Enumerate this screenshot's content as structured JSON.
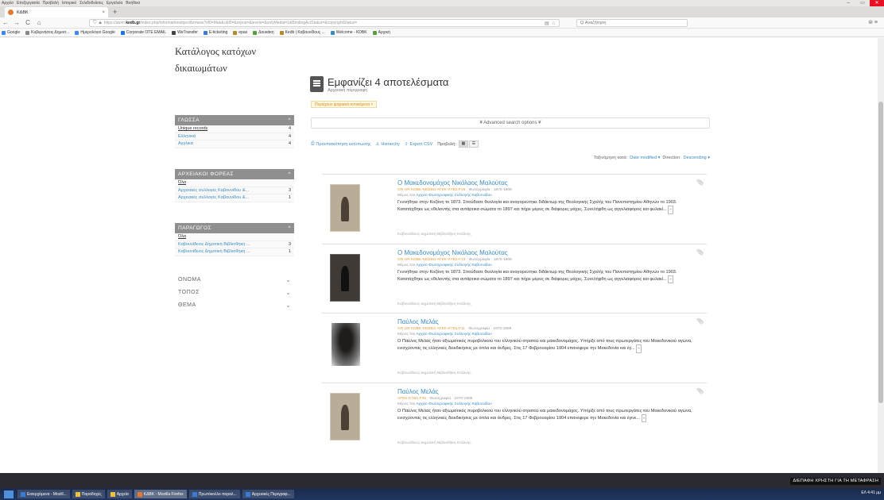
{
  "window": {
    "menu": [
      "Αρχείο",
      "Επεξεργασία",
      "Προβολή",
      "Ιστορικό",
      "Σελιδοδείκτες",
      "Εργαλεία",
      "Βοήθεια"
    ],
    "minimize": "–",
    "maximize": "▭",
    "close": "✕"
  },
  "tab": {
    "title": "ΚΔΒΚ",
    "close": "×",
    "new": "+"
  },
  "nav": {
    "back": "←",
    "forward": "→",
    "reload": "C",
    "home": "⌂",
    "url_prefix": "https://atom.",
    "url_domain": "kedb.gr",
    "url_path": "/index.php/informationobject/browse?sf0=Mak&c&f0=&repos=&levels=&onlyMedia=1&BindingActStatus=&copyrightStatus=",
    "search_placeholder": "Q Αναζήτηση",
    "right": "⊜ ≡"
  },
  "bookmarks": [
    {
      "label": "Google",
      "color": "#4285f4"
    },
    {
      "label": "Κυβερνήσεις Δημοσ...",
      "color": "#888888"
    },
    {
      "label": "Ημερολόγιο Google",
      "color": "#4285f4"
    },
    {
      "label": "Corporate OTE EMAIL",
      "color": "#1a73e8"
    },
    {
      "label": "WeTransfer",
      "color": "#444444"
    },
    {
      "label": "E-ticketing",
      "color": "#3a7bd5"
    },
    {
      "label": "epas",
      "color": "#b58a2e"
    },
    {
      "label": "Δουκάκη",
      "color": "#5a9c3a"
    },
    {
      "label": "Kedb | Καβουνίδους ...",
      "color": "#b58a2e"
    },
    {
      "label": "Welcome - KDBK",
      "color": "#3a8bbf"
    },
    {
      "label": "Αρχική",
      "color": "#5a9c3a"
    }
  ],
  "sidebar": {
    "title": "Κατάλογος κατόχων δικαιωμάτων",
    "facets": [
      {
        "heading": "ΓΛΩΣΣΑ",
        "rows": [
          {
            "label": "Unique records",
            "count": "4",
            "selected": true
          },
          {
            "label": "Ελληνικά",
            "count": "4"
          },
          {
            "label": "Αγγλικά",
            "count": "4"
          }
        ]
      },
      {
        "heading": "ΑΡΧΕΙΑΚΟΙ ΦΟΡΕΑΣ",
        "rows": [
          {
            "label": "Όλα",
            "count": "",
            "selected": true
          },
          {
            "label": "Αρχειακές συλλογές Καβουνίδου &...",
            "count": "3"
          },
          {
            "label": "Αρχειακές συλλογές Καβουνίδου &...",
            "count": "1"
          }
        ]
      },
      {
        "heading": "ΠΑΡΑΓΩΓΟΣ",
        "rows": [
          {
            "label": "Όλα",
            "count": "",
            "selected": true
          },
          {
            "label": "Καβουνίδειος Δημοτική Βιβλιοθήκη ...",
            "count": "3"
          },
          {
            "label": "Καβουνίδειος Δημοτική Βιβλιοθήκη ...",
            "count": "1"
          }
        ]
      }
    ],
    "collapsed": [
      "ΟΝΟΜΑ",
      "ΤΟΠΟΣ",
      "ΘΕΜΑ"
    ]
  },
  "main": {
    "title": "Εμφανίζει 4 αποτελέσματα",
    "subtitle": "Αρχειακή περιγραφή",
    "filter_tag": "Περιέχουν ψηφιακά αντικείμενα ×",
    "advanced": "¥ Advanced search options ¥",
    "toolbar": {
      "print": "Προεπισκόπηση εκτύπωσης",
      "hierarchy": "Hierarchy",
      "export": "Export CSV",
      "view_label": "Προβολή:"
    },
    "sort": {
      "label": "Ταξινόμηση κατά:",
      "by": "Date modified",
      "dir_label": "Direction:",
      "dir": "Descending"
    }
  },
  "results": [
    {
      "title": "Ο Μακεδονομάχος Νικόλαος Μαλούτας",
      "ref": "GR GR KDBK KEDBO AFEK-KTB1-F15",
      "level": "Φωτογραφία · 1870-1908",
      "part_prefix": "Μέρος του",
      "part_link": "Αρχείο Φωτογραφικής Συλλογής Καβουνίδου",
      "desc": "Γεννήθηκε στην Κοζάνη το 1873. Σπούδασε θεολογία και αναγορεύτηκε διδάκτωρ της Θεολογικής Σχολής του Πανεπιστημίου Αθηνών το 1903. Κατατάχθηκε ως εθελοντής στα αντάρτικα σώματα το 1897 και πήρε μέρος σε διάφορες μάχες. Συνελήφθη ως αγγελιαφόρος και φυλακί...",
      "more": "»",
      "creator": "Καβουνίδειος Δημοτική Βιβλιοθήκη Κοζάνης"
    },
    {
      "title": "Ο Μακεδονομάχος Νικόλαος Μαλούτας",
      "ref": "GR GR KDBK KEDBO AFEK-KTB1-F13",
      "level": "Φωτογραφία · 1870-1908",
      "part_prefix": "Μέρος του",
      "part_link": "Αρχείο Φωτογραφικής Συλλογής Καβουνίδου",
      "desc": "Γεννήθηκε στην Κοζάνη το 1873. Σπούδασε θεολογία και αναγορεύτηκε διδάκτωρ της Θεολογικής Σχολής του Πανεπιστημίου Αθηνών το 1903. Κατατάχθηκε ως εθελοντής στα αντάρτικα σώματα το 1897 και πήρε μέρος σε διάφορες μάχες. Συνελήφθη ως αγγελιαφόρος και φυλακί...",
      "more": "»",
      "creator": "Καβουνίδειος Δημοτική Βιβλιοθήκη Κοζάνης"
    },
    {
      "title": "Παύλος Μελάς",
      "ref": "GR GR KDBK KEDBO AFEK-KTB1-F11",
      "level": "Φωτογραφία · 1870-1908",
      "part_prefix": "Μέρος του",
      "part_link": "Αρχείο Φωτογραφικής Συλλογής Καβουνίδου",
      "desc": "Ο Παύλος Μελάς ήταν αξιωματικός πυροβολικού του ελληνικού στρατού και μακεδονομάχος. Υπήρξε από τους πρωτεργάτες του Μακεδονικού αγώνα, ενισχύοντας τις ελληνικές διεκδικήσεις με όπλα και άνδρες. Στις 17 Φεβρουαρίου 1904 επανέφερε την Μακεδονία και έγ...",
      "more": "»",
      "creator": "Καβουνίδειος Δημοτική Βιβλιοθήκη Κοζάνης"
    },
    {
      "title": "Παύλος Μελάς",
      "ref": "AFEK-KTB1-F35",
      "level": "Φωτογραφία · 1870-1908",
      "part_prefix": "Μέρος του",
      "part_link": "Αρχείο Φωτογραφικής Συλλογής Καβουνίδου",
      "desc": "Ο Παύλος Μελάς ήταν αξιωματικός πυροβολικού του ελληνικού στρατού και μακεδονομάχος. Υπήρξε από τους πρωτεργάτες του Μακεδονικού αγώνα, ενισχύοντας τις ελληνικές διεκδικήσεις με όπλα και άνδρες. Στις 17 Φεβρουαρίου 1904 επανέφερε την Μακεδονία και έγινε...",
      "more": "»",
      "creator": "Καβουνίδειος Δημοτική Βιβλιοθήκη Κοζάνης"
    }
  ],
  "taskbar": {
    "ime": "ΔΙΕΠΑΦΗ ΧΡΗΣΤΗ ΓΙΑ ΤΗ ΜΕΤΑΦΡΑΣΗ",
    "tasks": [
      {
        "label": "Εισερχόμενα - Mozill...",
        "color": "#3a7bd5",
        "active": false
      },
      {
        "label": "Παραδοχές",
        "color": "#f0c040",
        "active": false
      },
      {
        "label": "Αρχεία",
        "color": "#f0c040",
        "active": false
      },
      {
        "label": "ΚΔΒΚ - Mozilla Firefox",
        "color": "#e8772e",
        "active": true
      },
      {
        "label": "Πρωτόκολλο παραλ...",
        "color": "#3a7bd5",
        "active": false
      },
      {
        "label": "Αρχειακές Περιγραφ...",
        "color": "#3a7bd5",
        "active": false
      }
    ],
    "tray": "ΕΛ 4:41 μμ"
  }
}
